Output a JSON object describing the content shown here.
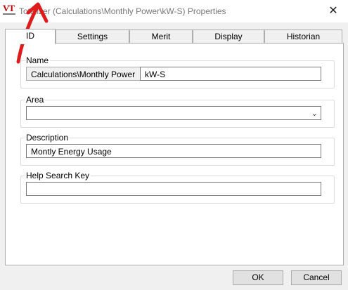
{
  "window": {
    "title": "Totalizer (Calculations\\Monthly Power\\kW-S) Properties",
    "logo_text": "VT",
    "close_symbol": "✕"
  },
  "tabs": [
    {
      "label": "ID",
      "active": true
    },
    {
      "label": "Settings",
      "active": false
    },
    {
      "label": "Merit",
      "active": false
    },
    {
      "label": "Display",
      "active": false
    },
    {
      "label": "Historian",
      "active": false
    }
  ],
  "name_group": {
    "label": "Name",
    "prefix_value": "Calculations\\Monthly Power",
    "name_value": "kW-S"
  },
  "area_group": {
    "label": "Area",
    "value": "",
    "chevron": "⌄"
  },
  "description_group": {
    "label": "Description",
    "value": "Montly Energy Usage"
  },
  "help_group": {
    "label": "Help Search Key",
    "value": ""
  },
  "buttons": {
    "ok": "OK",
    "cancel": "Cancel"
  },
  "colors": {
    "annotation_arrow": "#e01b1b",
    "logo": "#c00000"
  }
}
